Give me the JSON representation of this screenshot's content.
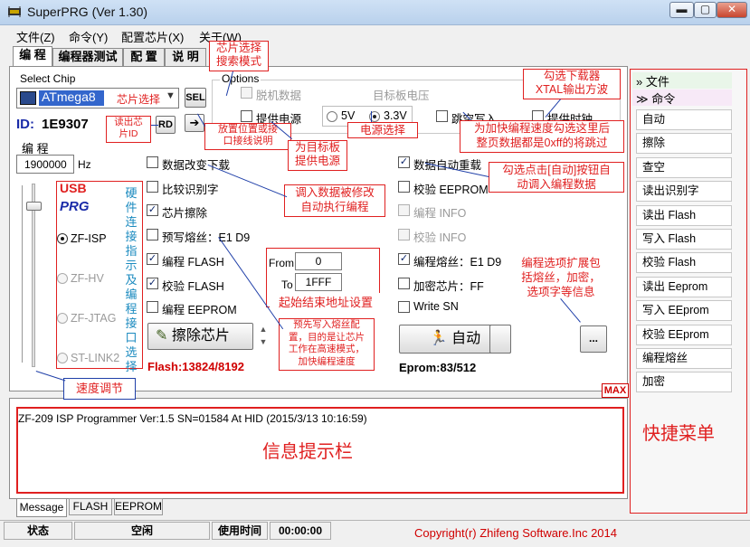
{
  "window": {
    "title": "SuperPRG (Ver 1.30)"
  },
  "menu": [
    "文件(Z)",
    "命令(Y)",
    "配置芯片(X)",
    "关于(W)"
  ],
  "tabs": [
    "编 程",
    "编程器测试",
    "配 置",
    "说 明"
  ],
  "chip": {
    "group_label": "Select Chip",
    "selected": "ATmega8",
    "select_hint": "芯片选择",
    "sel_button": "SEL",
    "id_label": "ID:",
    "id_value": "1E9307",
    "rd_button": "RD"
  },
  "options": {
    "group_label": "Options",
    "offline": "脱机数据",
    "target_voltage": "目标板电压",
    "supply_power": "提供电源",
    "v5": "5V",
    "v33": "3.3V",
    "skip_write": "跳空写入",
    "provide_clock": "提供时钟"
  },
  "program": {
    "label": "编 程",
    "freq_value": "1900000",
    "freq_unit": "Hz"
  },
  "checks_left": [
    {
      "label": "数据改变下载",
      "checked": false
    },
    {
      "label": "比较识别字",
      "checked": false
    },
    {
      "label": "芯片擦除",
      "checked": true
    },
    {
      "label": "预写熔丝：E1 D9",
      "checked": false
    },
    {
      "label": "编程 FLASH",
      "checked": true
    },
    {
      "label": "校验 FLASH",
      "checked": true
    },
    {
      "label": "编程 EEPROM",
      "checked": false
    }
  ],
  "checks_right": [
    {
      "label": "数据自动重载",
      "checked": true,
      "disabled": false
    },
    {
      "label": "校验 EEPROM",
      "checked": false,
      "disabled": false
    },
    {
      "label": "编程 INFO",
      "checked": false,
      "disabled": true
    },
    {
      "label": "校验 INFO",
      "checked": false,
      "disabled": true
    },
    {
      "label": "编程熔丝：E1 D9",
      "checked": true,
      "disabled": false
    },
    {
      "label": "加密芯片：FF",
      "checked": false,
      "disabled": false
    },
    {
      "label": "Write SN",
      "checked": false,
      "disabled": false
    }
  ],
  "range": {
    "from_label": "From",
    "from_value": "0",
    "to_label": "To",
    "to_value": "1FFF"
  },
  "erase_button": "擦除芯片",
  "auto_button": "自动",
  "more_button": "...",
  "flash_status": "Flash:13824/8192",
  "eprom_status": "Eprom:83/512",
  "max_badge": "MAX",
  "interface": {
    "usb": "USB",
    "prg": "PRG",
    "options": [
      "ZF-ISP",
      "ZF-HV",
      "ZF-JTAG",
      "ST-LINK2"
    ],
    "selected": "ZF-ISP"
  },
  "log": {
    "text": "ZF-209 ISP Programmer Ver:1.5 SN=01584 At HID (2015/3/13 10:16:59)"
  },
  "bottom_tabs": [
    "Message",
    "FLASH",
    "EEPROM"
  ],
  "statusbar": {
    "state_label": "状态",
    "state_value": "空闲",
    "time_label": "使用时间",
    "time_value": "00:00:00",
    "copyright": "Copyright(r) Zhifeng Software.Inc 2014"
  },
  "sidebar": {
    "headers": [
      "文件",
      "命令"
    ],
    "items": [
      "自动",
      "擦除",
      "查空",
      "读出识别字",
      "读出 Flash",
      "写入 Flash",
      "校验 Flash",
      "读出 Eeprom",
      "写入 EEprom",
      "校验 EEprom",
      "编程熔丝",
      "加密"
    ]
  },
  "annotations": {
    "chip_search": "芯片选择\n搜索模式",
    "xtal": "勾选下载器\nXTAL输出方波",
    "read_id": "读出芯\n片ID",
    "place_pos": "放置位置或接\n口接线说明",
    "target_power": "为目标板\n提供电源",
    "power_select": "电源选择",
    "speed_skip": "为加快编程速度勾选这里后\n整页数据都是0xff的将跳过",
    "auto_load": "勾选点击[自动]按钮自\n动调入编程数据",
    "hw_interface": "硬件连接指示及编程接口选择",
    "reload_prog": "调入数据被修改\n自动执行编程",
    "option_ext": "编程选项扩展包\n括熔丝，加密，\n选项字等信息",
    "start_end": "起始结束地址设置",
    "prewrite": "预先写入熔丝配\n置，目的是让芯片\n工作在高速模式，\n加快编程速度",
    "speed_adjust": "速度调节",
    "info_bar": "信息提示栏",
    "quick_menu": "快捷菜单"
  },
  "colors": {
    "annotation_red": "#e02020",
    "annotation_blue": "#1f3fa8",
    "accent_red": "#d00000"
  }
}
